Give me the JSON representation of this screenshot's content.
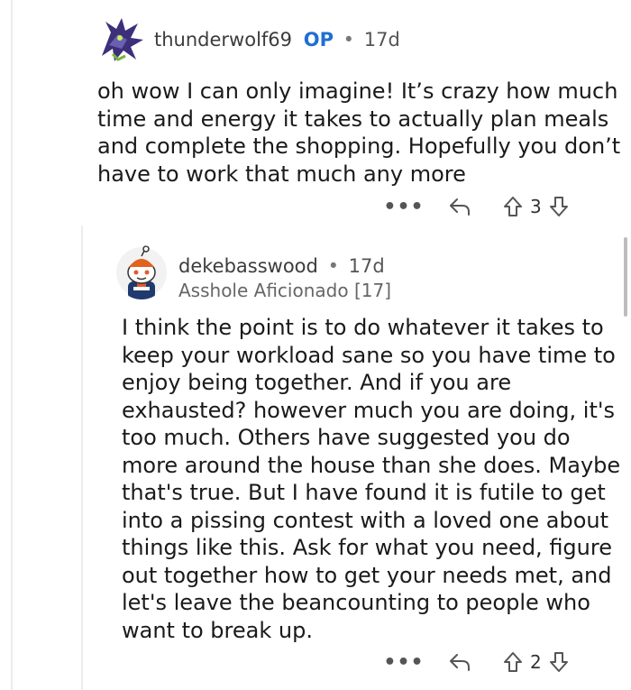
{
  "comments": [
    {
      "username": "thunderwolf69",
      "op_badge": "OP",
      "separator": "•",
      "age": "17d",
      "lines": [
        "oh wow I can only imagine! It’s crazy how much",
        "time and energy it takes to actually plan meals",
        "and complete the shopping. Hopefully you don’t",
        "have to work that much any more"
      ],
      "more_label": "•••",
      "score": "3",
      "avatar_icon": "dragon-avatar-icon"
    },
    {
      "username": "dekebasswood",
      "separator": "•",
      "age": "17d",
      "flair": "Asshole Aficionado [17]",
      "lines": [
        "I think the point is to do whatever it takes to",
        "keep your workload sane so you have time to",
        "enjoy being together. And if you are",
        "exhausted? however much you are doing, it's",
        "too much. Others have suggested you do",
        "more around the house than she does. Maybe",
        "that's true. But I have found it is futile to get",
        "into a pissing contest with a loved one about",
        "things like this. Ask for what you need, figure",
        "out together how to get your needs met, and",
        "let's leave the beancounting to people who",
        "want to break up."
      ],
      "more_label": "•••",
      "score": "2",
      "avatar_icon": "snoo-avatar-icon"
    }
  ],
  "icons": {
    "reply": "reply-arrow-icon",
    "upvote": "upvote-arrow-icon",
    "downvote": "downvote-arrow-icon"
  },
  "colors": {
    "op_badge": "#1f6fd1",
    "thread_line": "#ececec"
  }
}
